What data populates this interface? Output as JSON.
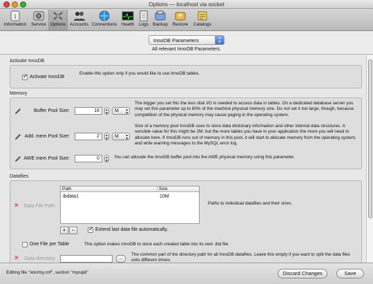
{
  "window": {
    "title": "Options — localhost via socket"
  },
  "toolbar": {
    "items": [
      {
        "label": "Information",
        "icon": "information-icon"
      },
      {
        "label": "Service",
        "icon": "service-icon"
      },
      {
        "label": "Options",
        "icon": "options-icon",
        "active": true
      },
      {
        "label": "Accounts",
        "icon": "accounts-icon"
      },
      {
        "label": "Connections",
        "icon": "connections-icon"
      },
      {
        "label": "Health",
        "icon": "health-icon"
      },
      {
        "label": "Logs",
        "icon": "logs-icon"
      },
      {
        "label": "Backup",
        "icon": "backup-icon"
      },
      {
        "label": "Restore",
        "icon": "restore-icon"
      },
      {
        "label": "Catalogs",
        "icon": "catalogs-icon"
      }
    ]
  },
  "selector": {
    "value": "InnoDB Parameters",
    "subtitle": "All relevant InnoDB Parameters."
  },
  "activate": {
    "section_label": "Activate InnoDB",
    "checkbox_label": "Activate InnoDB",
    "checked": true,
    "description": "Enable this option only if you would like to use InnoDB tables."
  },
  "memory": {
    "section_label": "Memory",
    "buffer_pool": {
      "label": "Buffer Pool Size:",
      "value": "16",
      "unit": "M",
      "description": "The bigger you set this the less disk I/O is needed to access data in tables. On a dedicated database server you may set this parameter up to 80% of the machine physical memory size. Do not set it too large, though, because competition of the physical memory may cause paging in the operating system."
    },
    "add_mem_pool": {
      "label": "Add. mem Pool Size:",
      "value": "2",
      "unit": "M",
      "description": "Size of a memory pool InnoDB uses to store data dictionary information and other internal data structures. A sensible value for this might be 2M, but the more tables you have in your application the more you will need to allocate here. If InnoDB runs out of memory in this pool, it will start to allocate memory from the operating system, and write warning messages to the MySQL error log."
    },
    "awe_mem_pool": {
      "label": "AWE mem Pool Size:",
      "value": "0",
      "description": "You can allocate the InnoDB buffer pool into the AWE physical memory using this parameter."
    }
  },
  "datafiles": {
    "section_label": "Datafiles",
    "data_file_path": {
      "label": "Data File Path:",
      "col_path": "Path",
      "col_size": "Size",
      "rows": [
        {
          "path": "ibdata1",
          "size": "10M"
        }
      ],
      "description": "Paths to individual datafiles and their sizes.",
      "add_label": "+",
      "remove_label": "−",
      "extend_label": "Extend last data file automatically.",
      "extend_checked": true
    },
    "one_file_per_table": {
      "label": "One File per Table",
      "checked": false,
      "description": "This option makes InnoDB to store each created table into its own .ibd file."
    },
    "data_directory": {
      "label": "Data directory:",
      "value": "",
      "browse_label": "...",
      "description": "The common part of the directory path for all InnoDB datafiles. Leave this empty if you want to split the data files onto different drives."
    }
  },
  "status": {
    "text": "Editing file \"/etc/my.cnf\", section \"mysqld\"",
    "discard_label": "Discard Changes",
    "save_label": "Save"
  }
}
